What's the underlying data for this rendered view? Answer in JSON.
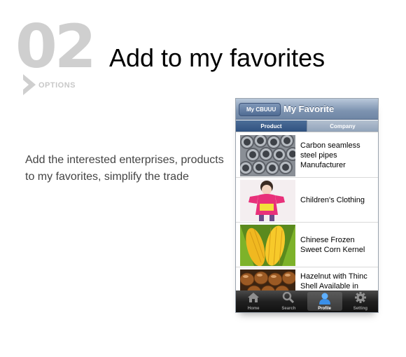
{
  "step": {
    "number": "02",
    "label": "OPTIONS"
  },
  "headline": "Add to my favorites",
  "description": "Add the interested enterprises, products to my favorites, simplify the trade",
  "phone": {
    "back_button": "My CBUUU",
    "title": "My Favorite",
    "segments": [
      {
        "label": "Product",
        "active": true
      },
      {
        "label": "Company",
        "active": false
      }
    ],
    "items": [
      {
        "name": "Carbon seamless steel pipes Manufacturer",
        "image": "steel-pipes"
      },
      {
        "name": "Children's Clothing",
        "image": "child-clothing"
      },
      {
        "name": "Chinese Frozen Sweet Corn Kernel",
        "image": "corn"
      },
      {
        "name": "Hazelnut with Thinc Shell Available in",
        "image": "hazelnuts"
      }
    ],
    "tabs": [
      {
        "label": "Home",
        "icon": "home-icon",
        "active": false
      },
      {
        "label": "Search",
        "icon": "search-icon",
        "active": false
      },
      {
        "label": "Profile",
        "icon": "profile-icon",
        "active": true
      },
      {
        "label": "Setting",
        "icon": "gear-icon",
        "active": false
      }
    ]
  },
  "colors": {
    "step_number": "#cfcfcf",
    "navbar": "#7d93b0",
    "segment_active": "#2f5180",
    "tabbar": "#202020"
  }
}
